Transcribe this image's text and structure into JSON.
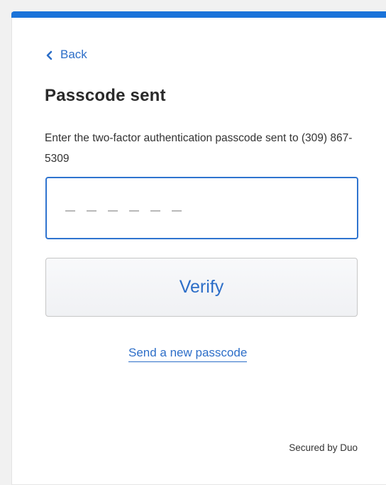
{
  "nav": {
    "back_label": "Back"
  },
  "main": {
    "title": "Passcode sent",
    "description": "Enter the two-factor authentication passcode sent to (309) 867-5309",
    "passcode_input": {
      "value": "",
      "placeholder": "– – – – – –"
    },
    "verify_label": "Verify",
    "resend_label": "Send a new passcode"
  },
  "footer": {
    "secured_text": "Secured by Duo"
  },
  "icons": {
    "back": "chevron-left-icon"
  },
  "colors": {
    "accent": "#1a73d9",
    "link": "#2c6ec8",
    "input_focus_border": "#2f74cf"
  }
}
